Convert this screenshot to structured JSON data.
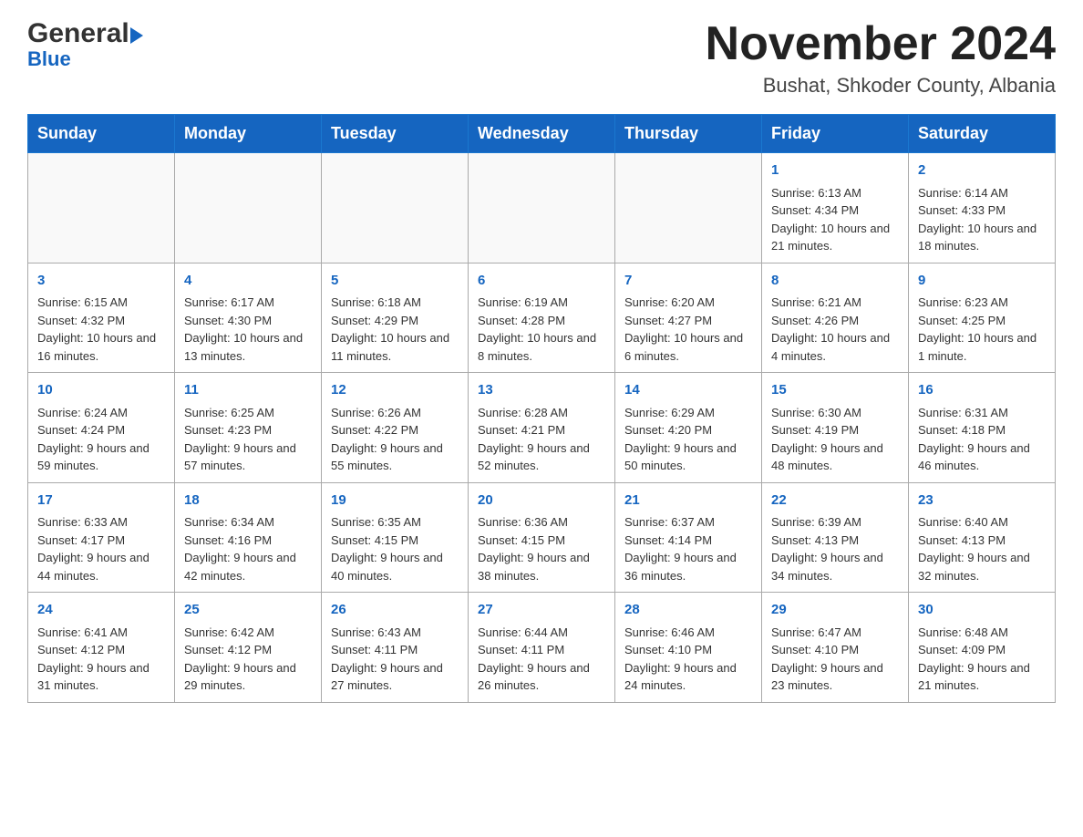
{
  "logo": {
    "general": "General",
    "blue": "Blue"
  },
  "header": {
    "title": "November 2024",
    "subtitle": "Bushat, Shkoder County, Albania"
  },
  "weekdays": [
    "Sunday",
    "Monday",
    "Tuesday",
    "Wednesday",
    "Thursday",
    "Friday",
    "Saturday"
  ],
  "weeks": [
    [
      {
        "day": "",
        "info": ""
      },
      {
        "day": "",
        "info": ""
      },
      {
        "day": "",
        "info": ""
      },
      {
        "day": "",
        "info": ""
      },
      {
        "day": "",
        "info": ""
      },
      {
        "day": "1",
        "info": "Sunrise: 6:13 AM\nSunset: 4:34 PM\nDaylight: 10 hours and 21 minutes."
      },
      {
        "day": "2",
        "info": "Sunrise: 6:14 AM\nSunset: 4:33 PM\nDaylight: 10 hours and 18 minutes."
      }
    ],
    [
      {
        "day": "3",
        "info": "Sunrise: 6:15 AM\nSunset: 4:32 PM\nDaylight: 10 hours and 16 minutes."
      },
      {
        "day": "4",
        "info": "Sunrise: 6:17 AM\nSunset: 4:30 PM\nDaylight: 10 hours and 13 minutes."
      },
      {
        "day": "5",
        "info": "Sunrise: 6:18 AM\nSunset: 4:29 PM\nDaylight: 10 hours and 11 minutes."
      },
      {
        "day": "6",
        "info": "Sunrise: 6:19 AM\nSunset: 4:28 PM\nDaylight: 10 hours and 8 minutes."
      },
      {
        "day": "7",
        "info": "Sunrise: 6:20 AM\nSunset: 4:27 PM\nDaylight: 10 hours and 6 minutes."
      },
      {
        "day": "8",
        "info": "Sunrise: 6:21 AM\nSunset: 4:26 PM\nDaylight: 10 hours and 4 minutes."
      },
      {
        "day": "9",
        "info": "Sunrise: 6:23 AM\nSunset: 4:25 PM\nDaylight: 10 hours and 1 minute."
      }
    ],
    [
      {
        "day": "10",
        "info": "Sunrise: 6:24 AM\nSunset: 4:24 PM\nDaylight: 9 hours and 59 minutes."
      },
      {
        "day": "11",
        "info": "Sunrise: 6:25 AM\nSunset: 4:23 PM\nDaylight: 9 hours and 57 minutes."
      },
      {
        "day": "12",
        "info": "Sunrise: 6:26 AM\nSunset: 4:22 PM\nDaylight: 9 hours and 55 minutes."
      },
      {
        "day": "13",
        "info": "Sunrise: 6:28 AM\nSunset: 4:21 PM\nDaylight: 9 hours and 52 minutes."
      },
      {
        "day": "14",
        "info": "Sunrise: 6:29 AM\nSunset: 4:20 PM\nDaylight: 9 hours and 50 minutes."
      },
      {
        "day": "15",
        "info": "Sunrise: 6:30 AM\nSunset: 4:19 PM\nDaylight: 9 hours and 48 minutes."
      },
      {
        "day": "16",
        "info": "Sunrise: 6:31 AM\nSunset: 4:18 PM\nDaylight: 9 hours and 46 minutes."
      }
    ],
    [
      {
        "day": "17",
        "info": "Sunrise: 6:33 AM\nSunset: 4:17 PM\nDaylight: 9 hours and 44 minutes."
      },
      {
        "day": "18",
        "info": "Sunrise: 6:34 AM\nSunset: 4:16 PM\nDaylight: 9 hours and 42 minutes."
      },
      {
        "day": "19",
        "info": "Sunrise: 6:35 AM\nSunset: 4:15 PM\nDaylight: 9 hours and 40 minutes."
      },
      {
        "day": "20",
        "info": "Sunrise: 6:36 AM\nSunset: 4:15 PM\nDaylight: 9 hours and 38 minutes."
      },
      {
        "day": "21",
        "info": "Sunrise: 6:37 AM\nSunset: 4:14 PM\nDaylight: 9 hours and 36 minutes."
      },
      {
        "day": "22",
        "info": "Sunrise: 6:39 AM\nSunset: 4:13 PM\nDaylight: 9 hours and 34 minutes."
      },
      {
        "day": "23",
        "info": "Sunrise: 6:40 AM\nSunset: 4:13 PM\nDaylight: 9 hours and 32 minutes."
      }
    ],
    [
      {
        "day": "24",
        "info": "Sunrise: 6:41 AM\nSunset: 4:12 PM\nDaylight: 9 hours and 31 minutes."
      },
      {
        "day": "25",
        "info": "Sunrise: 6:42 AM\nSunset: 4:12 PM\nDaylight: 9 hours and 29 minutes."
      },
      {
        "day": "26",
        "info": "Sunrise: 6:43 AM\nSunset: 4:11 PM\nDaylight: 9 hours and 27 minutes."
      },
      {
        "day": "27",
        "info": "Sunrise: 6:44 AM\nSunset: 4:11 PM\nDaylight: 9 hours and 26 minutes."
      },
      {
        "day": "28",
        "info": "Sunrise: 6:46 AM\nSunset: 4:10 PM\nDaylight: 9 hours and 24 minutes."
      },
      {
        "day": "29",
        "info": "Sunrise: 6:47 AM\nSunset: 4:10 PM\nDaylight: 9 hours and 23 minutes."
      },
      {
        "day": "30",
        "info": "Sunrise: 6:48 AM\nSunset: 4:09 PM\nDaylight: 9 hours and 21 minutes."
      }
    ]
  ]
}
